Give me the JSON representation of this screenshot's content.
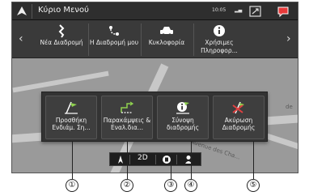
{
  "header": {
    "title": "Κύριο Μενού",
    "clock": "10:05"
  },
  "menu": {
    "items": [
      {
        "label": "Νέα Διαδρομή",
        "icon": "new-route-icon"
      },
      {
        "label": "Η Διαδρομή μου",
        "icon": "my-route-icon"
      },
      {
        "label": "Κυκλοφορία",
        "icon": "traffic-icon"
      },
      {
        "label": "Χρήσιμες Πληροφορ...",
        "icon": "info-icon"
      }
    ]
  },
  "panel": {
    "buttons": [
      {
        "label": "Προσθήκη Ενδιάμ. Ση...",
        "icon": "add-waypoint-icon"
      },
      {
        "label": "Παρακάμψεις & Εναλ.δια...",
        "icon": "detours-icon"
      },
      {
        "label": "Σύνοψη διαδρομής",
        "icon": "route-summary-icon"
      },
      {
        "label": "Ακύρωση Διαδρομής",
        "icon": "cancel-route-icon"
      }
    ]
  },
  "minibar": {
    "view_mode": "2D"
  },
  "map": {
    "labels": [
      "Avenue des Cha...",
      "de"
    ]
  },
  "callouts": [
    "①",
    "②",
    "③",
    "④",
    "⑤"
  ],
  "colors": {
    "top_bar": "#2e2e2e",
    "menu_bg": "#3a3a3a",
    "panel_bg": "#333333",
    "accent_green": "#8fd14f",
    "accent_red": "#e04040"
  }
}
